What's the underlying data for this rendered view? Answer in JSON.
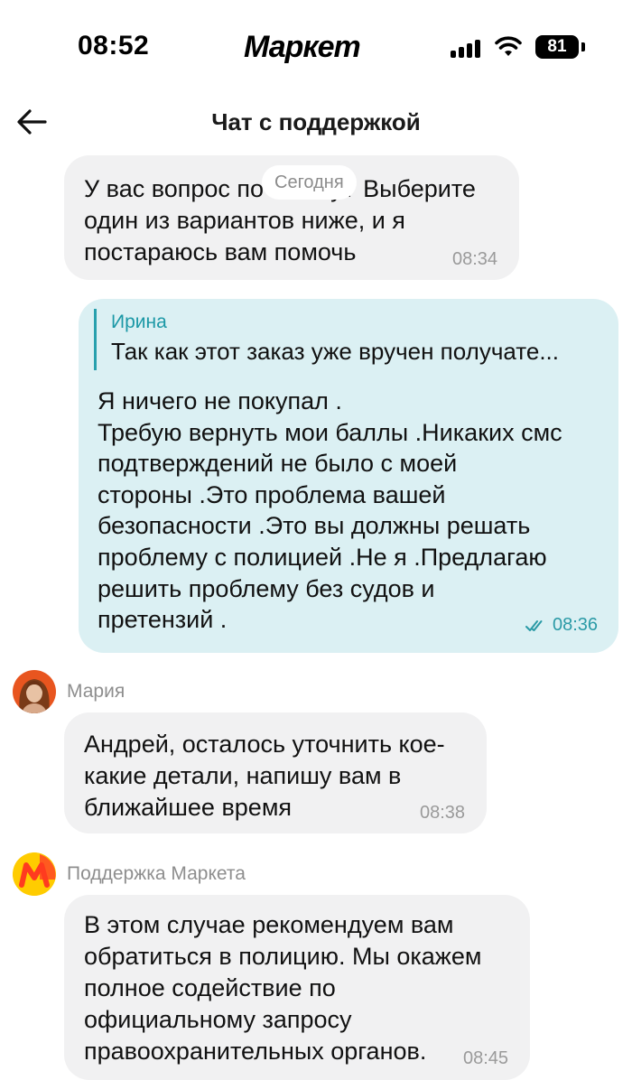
{
  "status_bar": {
    "time": "08:52",
    "brand": "Маркет",
    "battery": "81",
    "icons": [
      "signal-bars-icon",
      "wifi-icon",
      "battery-icon"
    ]
  },
  "header": {
    "title": "Чат с поддержкой",
    "back_icon": "arrow-left-icon"
  },
  "date_chip": "Сегодня",
  "messages": [
    {
      "direction": "incoming",
      "text": "У вас вопрос по заказу? Выберите\nодин из вариантов ниже, и я\nпостараюсь вам помочь",
      "time": "08:34"
    },
    {
      "direction": "outgoing",
      "quote": {
        "author": "Ирина",
        "text": "Так как этот заказ уже вручен получате..."
      },
      "text": "Я ничего не покупал .\nТребую вернуть мои баллы .Никаких смс\nподтверждений не было с моей\nстороны .Это проблема вашей\nбезопасности .Это вы должны решать\nпроблему с полицией .Не я .Предлагаю\nрешить проблему без судов и\nпретензий .",
      "time": "08:36",
      "status_icon": "double-check-icon"
    },
    {
      "direction": "incoming",
      "sender": "Мария",
      "text": "Андрей, осталось уточнить кое-\nкакие детали, напишу вам в\nближайшее время",
      "time": "08:38"
    },
    {
      "direction": "incoming",
      "sender": "Поддержка Маркета",
      "text": "В этом случае рекомендуем вам\nобратиться в полицию. Мы окажем\nполное содействие по\nофициальному запросу\nправоохранительных органов.",
      "time": "08:45"
    }
  ],
  "colors": {
    "incoming_bubble": "#f1f1f2",
    "outgoing_bubble": "#dbf0f3",
    "accent_teal": "#1b98a6",
    "market_yellow": "#ffcc00",
    "market_red": "#ff3b1f"
  }
}
